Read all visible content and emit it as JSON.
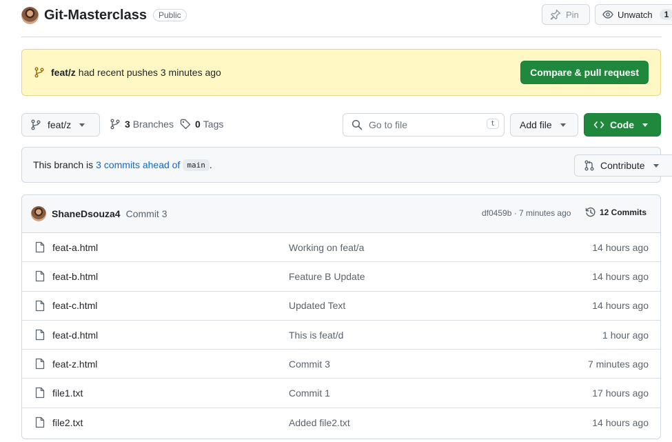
{
  "repo": {
    "name": "Git-Masterclass",
    "visibility": "Public"
  },
  "header_actions": {
    "pin_label": "Pin",
    "unwatch_label": "Unwatch",
    "watch_count": "1"
  },
  "banner": {
    "branch": "feat/z",
    "text": "had recent pushes 3 minutes ago",
    "compare_label": "Compare & pull request"
  },
  "toolbar": {
    "current_branch": "feat/z",
    "branches_count": "3",
    "branches_label": "Branches",
    "tags_count": "0",
    "tags_label": "Tags",
    "goto_placeholder": "Go to file",
    "goto_shortcut": "t",
    "add_file_label": "Add file",
    "code_label": "Code"
  },
  "ahead": {
    "prefix": "This branch is",
    "link": "3 commits ahead of",
    "base": "main",
    "suffix": ".",
    "contribute_label": "Contribute"
  },
  "latest_commit": {
    "author": "ShaneDsouza4",
    "message": "Commit 3",
    "sha_time": "df0459b · 7 minutes ago",
    "commits_label": "12 Commits"
  },
  "files": [
    {
      "name": "feat-a.html",
      "message": "Working on feat/a",
      "date": "14 hours ago"
    },
    {
      "name": "feat-b.html",
      "message": "Feature B Update",
      "date": "14 hours ago"
    },
    {
      "name": "feat-c.html",
      "message": "Updated Text",
      "date": "14 hours ago"
    },
    {
      "name": "feat-d.html",
      "message": "This is feat/d",
      "date": "1 hour ago"
    },
    {
      "name": "feat-z.html",
      "message": "Commit 3",
      "date": "7 minutes ago"
    },
    {
      "name": "file1.txt",
      "message": "Commit 1",
      "date": "17 hours ago"
    },
    {
      "name": "file2.txt",
      "message": "Added file2.txt",
      "date": "14 hours ago"
    }
  ],
  "colors": {
    "primary_green": "#1f883d",
    "banner_yellow": "#fff8c5",
    "link_blue": "#0969da"
  }
}
